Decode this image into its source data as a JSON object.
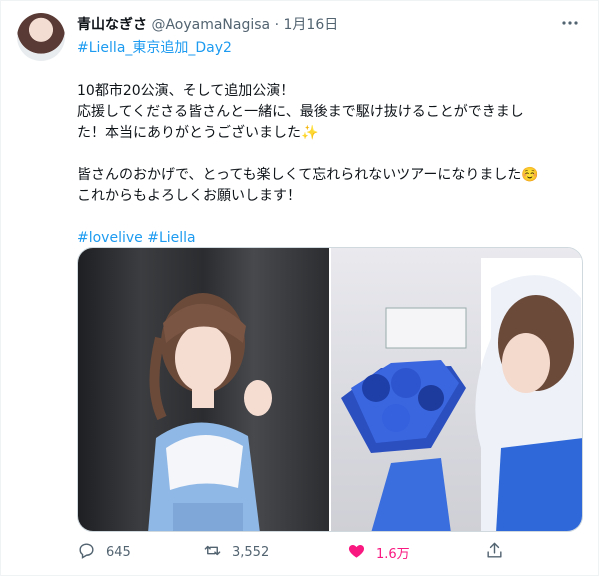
{
  "author": {
    "name": "青山なぎさ",
    "handle": "@AoyamaNagisa",
    "separator": "·",
    "date": "1月16日"
  },
  "tweet": {
    "hashtag_top": "#Liella_東京追加_Day2",
    "line1": "10都市20公演、そして追加公演！",
    "line2": "応援してくださる皆さんと一緒に、最後まで駆け抜けることができまし",
    "line3": "た！本当にありがとうございました✨",
    "line4": "皆さんのおかげで、とっても楽しくて忘れられないツアーになりました☺️",
    "line5": "これからもよろしくお願いします！",
    "tags_text": "#lovelive #Liella"
  },
  "actions": {
    "replies": "645",
    "retweets": "3,552",
    "likes": "1.6万"
  },
  "colors": {
    "accent": "#1d9bf0",
    "like": "#f91880",
    "muted": "#536471"
  },
  "icons": [
    "more-icon",
    "reply-icon",
    "retweet-icon",
    "like-icon",
    "share-icon"
  ]
}
